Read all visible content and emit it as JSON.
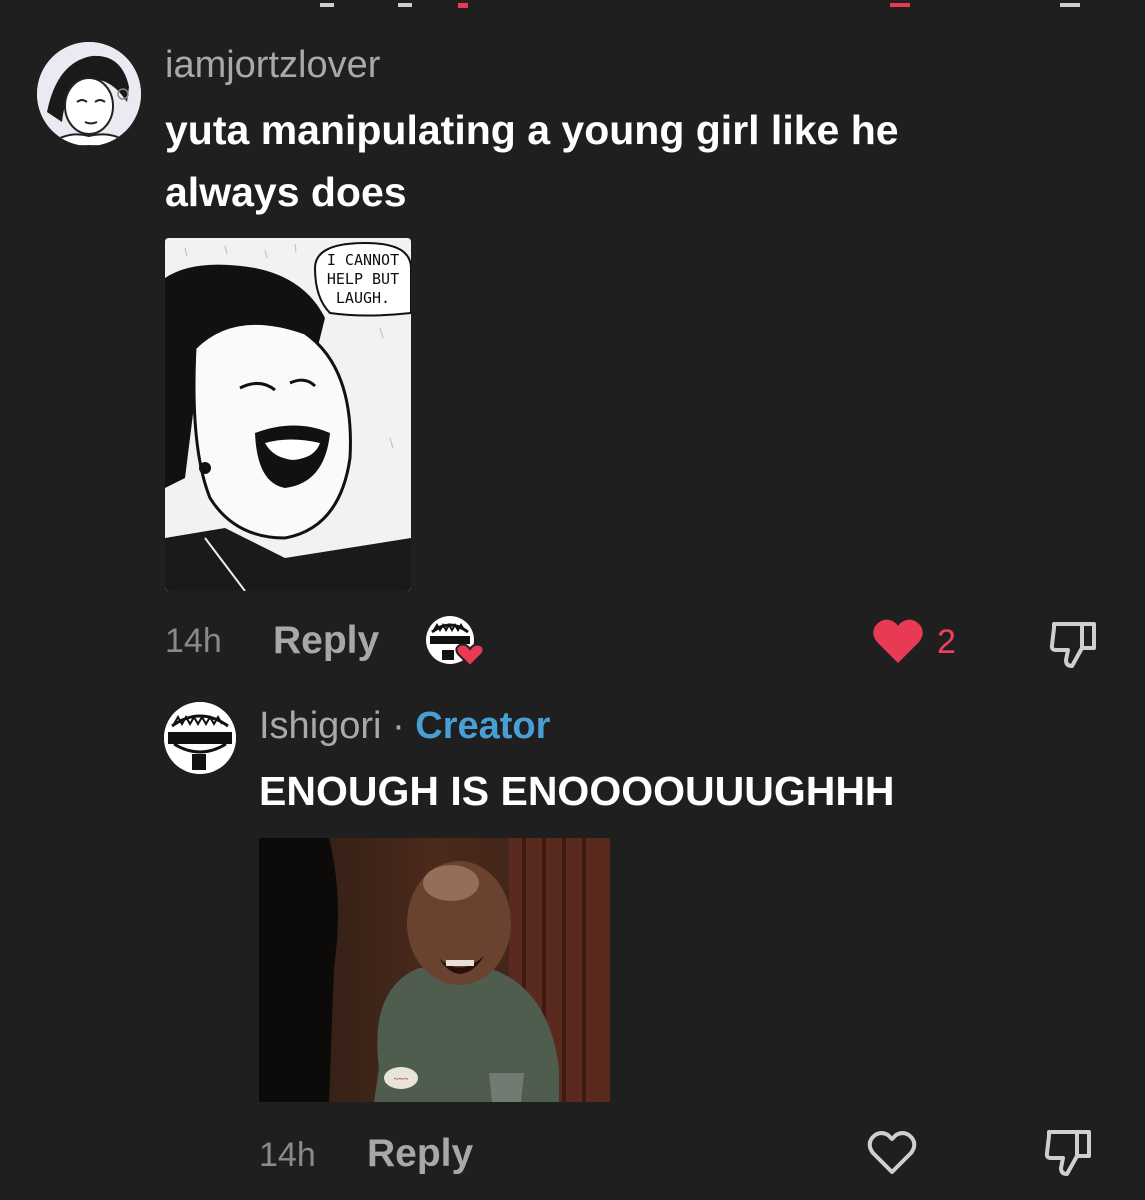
{
  "colors": {
    "background": "#1f1f1f",
    "text_primary": "#ffffff",
    "text_secondary": "#a9a9a9",
    "creator_accent": "#4a9ed6",
    "like_accent": "#f2405c"
  },
  "comments": [
    {
      "username": "iamjortzlover",
      "text": "yuta manipulating a young girl like he always does",
      "media": {
        "type": "manga-panel-image",
        "caption": "I CANNOT HELP BUT LAUGH."
      },
      "timestamp": "14h",
      "reply_label": "Reply",
      "liked_by_creator": true,
      "like_icon": "heart-filled-icon",
      "like_count": "2",
      "dislike_icon": "thumbs-down-icon"
    }
  ],
  "replies": [
    {
      "username": "Ishigori",
      "separator": "·",
      "badge": "Creator",
      "text": "ENOUGH IS ENOOOOUUUGHHH",
      "media": {
        "type": "gif-still-image"
      },
      "timestamp": "14h",
      "reply_label": "Reply",
      "like_icon": "heart-outline-icon",
      "dislike_icon": "thumbs-down-icon"
    }
  ]
}
